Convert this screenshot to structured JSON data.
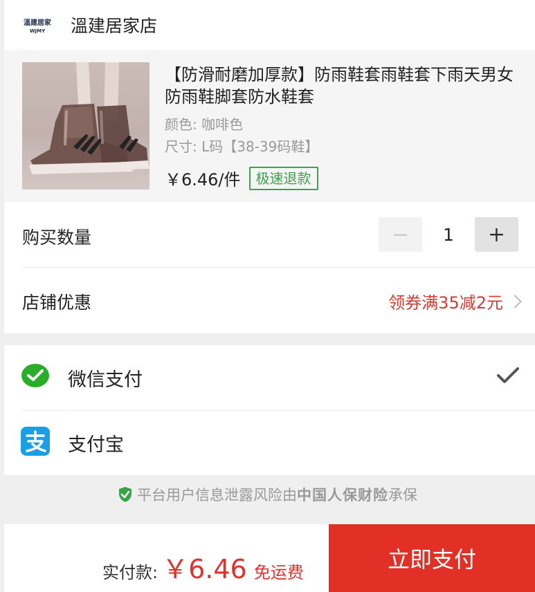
{
  "shop": {
    "logo_text": "溫建居家",
    "logo_subtext": "WJMY",
    "name": "溫建居家店"
  },
  "product": {
    "title": "【防滑耐磨加厚款】防雨鞋套雨鞋套下雨天男女防雨鞋脚套防水鞋套",
    "color_spec": "颜色: 咖啡色",
    "size_spec": "尺寸: L码【38-39码鞋】",
    "price": "￥6.46/件",
    "badge": "极速退款",
    "image_icon": "shoe-cover-image"
  },
  "quantity": {
    "label": "购买数量",
    "minus": "−",
    "plus": "+",
    "value": "1"
  },
  "coupon": {
    "label": "店铺优惠",
    "value": "领券满35减2元"
  },
  "payment": {
    "wechat_label": "微信支付",
    "wechat_icon": "wechat-icon",
    "alipay_label": "支付宝",
    "alipay_icon": "alipay-icon",
    "selected": "wechat"
  },
  "insurance": {
    "text_before": "平台用户信息泄露风险由",
    "insurer": "中国人保财险",
    "text_after": "承保"
  },
  "footer": {
    "total_label": "实付款:",
    "total_amount": "￥6.46",
    "shipping": "免运费",
    "pay_button": "立即支付"
  },
  "colors": {
    "accent_red": "#e23026",
    "price_red": "#e0322b",
    "coupon_red": "#d63b31",
    "badge_green": "#3aa34a",
    "wechat_green": "#2aae2a",
    "alipay_blue": "#1a9fe5"
  }
}
